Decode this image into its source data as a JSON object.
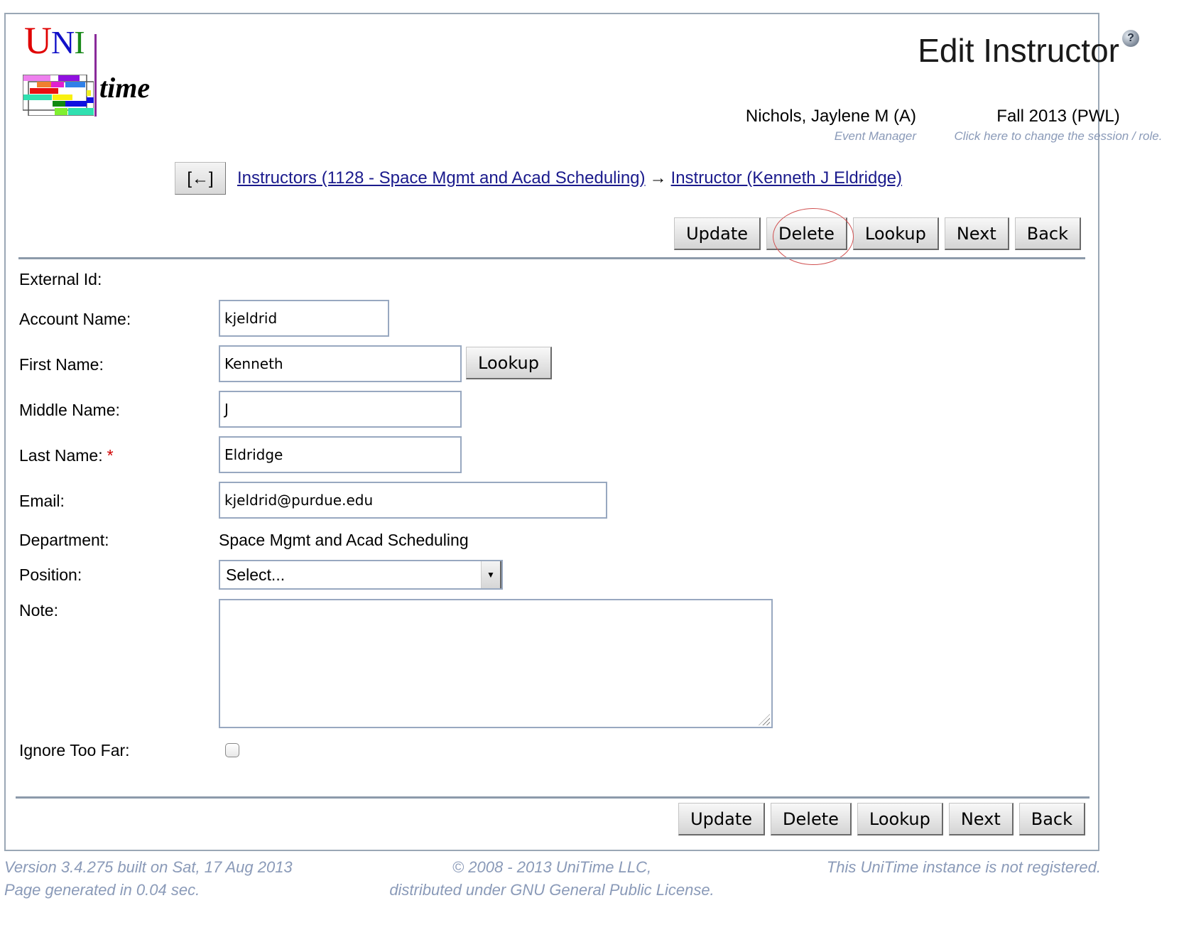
{
  "logo": {
    "uni_u": "U",
    "uni_n": "N",
    "uni_i": "I",
    "time": "time"
  },
  "header": {
    "title": "Edit Instructor",
    "help_icon": "?",
    "user": {
      "name": "Nichols, Jaylene M (A)",
      "role": "Event Manager"
    },
    "session": {
      "name": "Fall 2013 (PWL)",
      "change_label": "Click here to change the session / role."
    }
  },
  "nav": {
    "back_label": "[←]",
    "breadcrumb": [
      {
        "label": "Instructors (1128 - Space Mgmt and Acad Scheduling)"
      },
      {
        "label": "Instructor (Kenneth J Eldridge)"
      }
    ],
    "separator": "→"
  },
  "buttons": {
    "update": "Update",
    "delete": "Delete",
    "lookup": "Lookup",
    "next": "Next",
    "back": "Back"
  },
  "form": {
    "external_id": {
      "label": "External Id:",
      "value": ""
    },
    "account_name": {
      "label": "Account Name:",
      "value": "kjeldrid"
    },
    "first_name": {
      "label": "First Name:",
      "value": "Kenneth",
      "lookup_label": "Lookup"
    },
    "middle_name": {
      "label": "Middle Name:",
      "value": "J"
    },
    "last_name": {
      "label": "Last Name:",
      "value": "Eldridge",
      "required_mark": "*"
    },
    "email": {
      "label": "Email:",
      "value": "kjeldrid@purdue.edu"
    },
    "department": {
      "label": "Department:",
      "value": "Space Mgmt and Acad Scheduling"
    },
    "position": {
      "label": "Position:",
      "selected": "Select..."
    },
    "note": {
      "label": "Note:",
      "value": ""
    },
    "ignore_too_far": {
      "label": "Ignore Too Far:",
      "checked": false
    }
  },
  "footer": {
    "version": "Version 3.4.275 built on Sat, 17 Aug 2013",
    "generated": "Page generated in 0.04 sec.",
    "copyright": "© 2008 - 2013 UniTime LLC,",
    "license": "distributed under GNU General Public License.",
    "registration": "This UniTime instance is not registered."
  },
  "colors": {
    "link": "#1a1a8c",
    "muted": "#8a9ab8",
    "border": "#9aa7b5",
    "required": "#d00000",
    "highlight_circle": "#d05050"
  }
}
